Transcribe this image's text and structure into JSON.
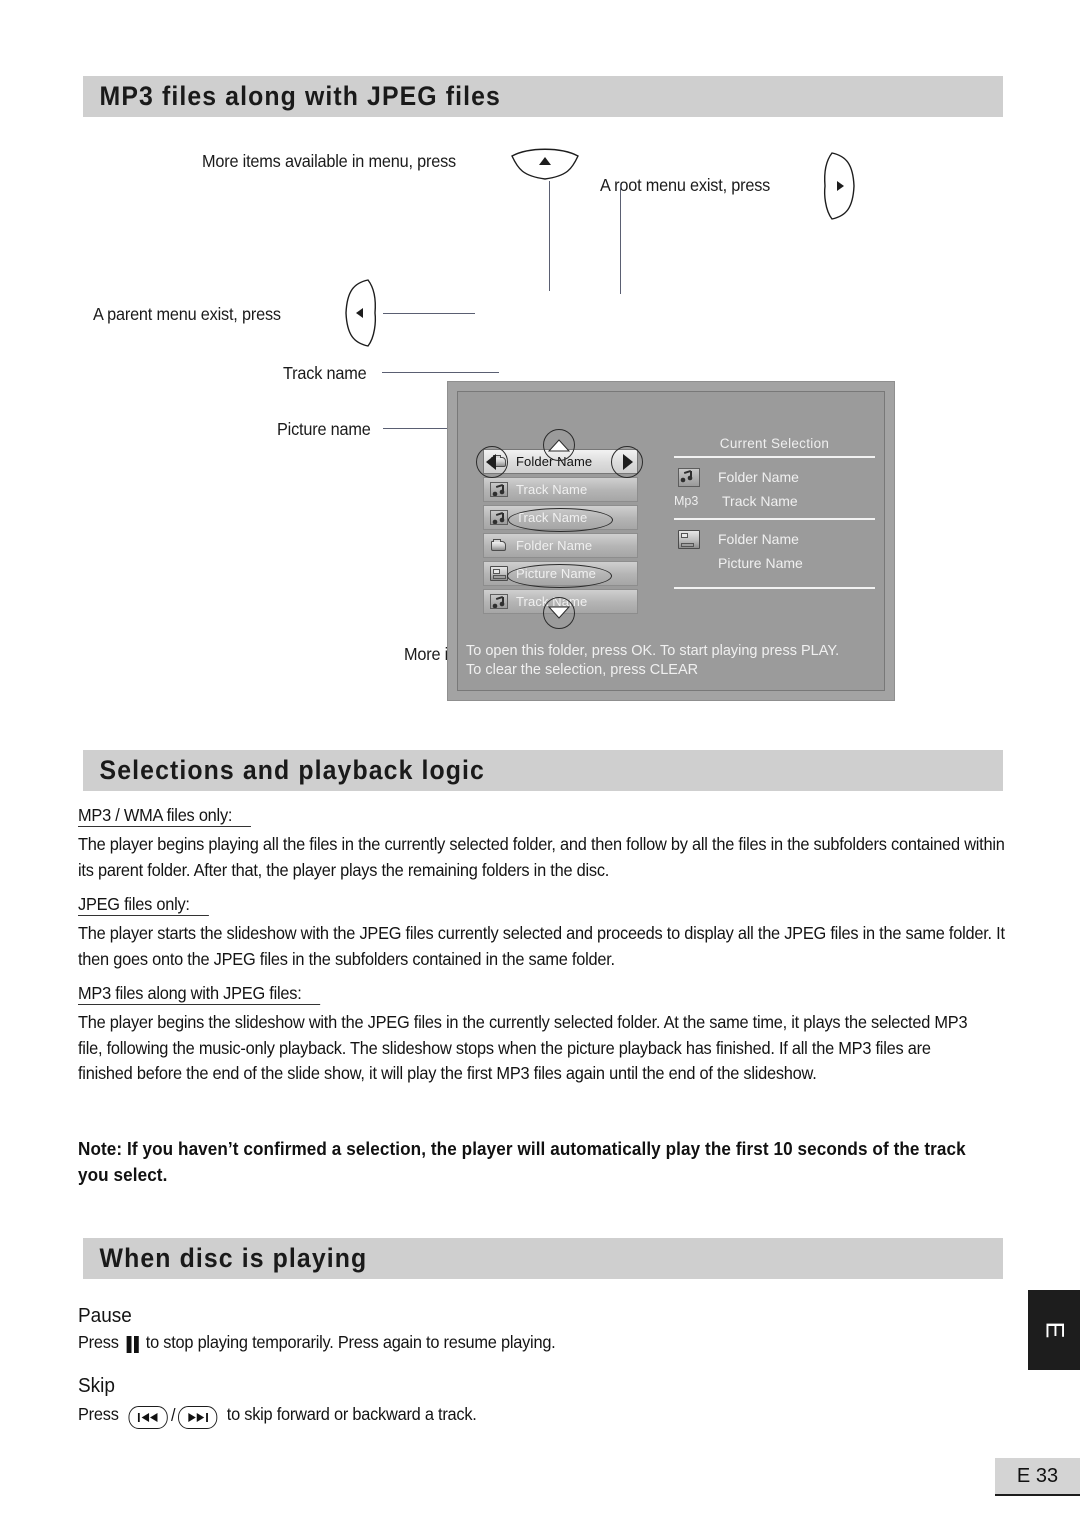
{
  "sections": {
    "mp3_jpeg": {
      "title": "MP3 files along with JPEG files"
    },
    "selections": {
      "title": "Selections and playback logic"
    },
    "when_playing": {
      "title": "When disc is playing"
    }
  },
  "diagram": {
    "callouts": {
      "more_items_top": "More items available in menu, press",
      "root_menu": "A root menu exist, press",
      "parent_menu": "A parent menu exist, press",
      "track_name": "Track name",
      "picture_name": "Picture name",
      "more_items_bottom": "More items available in menu, press"
    },
    "keys": {
      "up": "up-arrow-key",
      "down": "down-arrow-key",
      "left": "left-arrow-key",
      "right": "right-arrow-key"
    },
    "osd": {
      "menu_rows": [
        {
          "icon": "folder",
          "label": "Folder Name",
          "selected": true
        },
        {
          "icon": "music",
          "label": "Track Name",
          "selected": false
        },
        {
          "icon": "music",
          "label": "Track Name",
          "selected": false
        },
        {
          "icon": "folder",
          "label": "Folder Name",
          "selected": false
        },
        {
          "icon": "picture",
          "label": "Picture Name",
          "selected": false
        },
        {
          "icon": "music",
          "label": "Track Name",
          "selected": false
        }
      ],
      "current_selection": {
        "title": "Current Selection",
        "group_one": [
          {
            "icon": "music",
            "label": "Folder Name",
            "tag": ""
          },
          {
            "icon": "none",
            "label": "Track Name",
            "tag": "Mp3"
          }
        ],
        "group_two": [
          {
            "icon": "folder",
            "label": "Folder Name",
            "tag": ""
          },
          {
            "icon": "none",
            "label": "Picture Name",
            "tag": ""
          }
        ]
      },
      "hint_line_1": "To open this folder, press OK. To start playing press PLAY.",
      "hint_line_2": "To clear the selection, press CLEAR"
    }
  },
  "selections_body": {
    "mp3wma_heading": "MP3 / WMA files only:",
    "mp3wma_text": "The player begins playing all the files in the currently selected folder, and then follow by all the files in the subfolders contained within its parent folder.  After that, the player plays the remaining folders in the disc.",
    "jpeg_heading": "JPEG files only:",
    "jpeg_text": "The player starts the slideshow with the JPEG files currently selected and proceeds to display all the JPEG files in the same folder.  It then goes onto the JPEG files in the subfolders contained in the same folder.",
    "both_heading": "MP3 files along with JPEG files:",
    "both_text": "The player begins the slideshow with the JPEG files in the currently selected folder.  At the same time, it plays the selected MP3 file, following the music-only playback.  The slideshow stops when the picture playback has finished.  If all the MP3 files are finished before the end of the slide show, it will play the first MP3 files again until the end of the slideshow.",
    "note": "Note:  If you haven’t confirmed a selection, the player will automatically play the first 10 seconds of the track you select."
  },
  "when_playing_body": {
    "pause_heading": "Pause",
    "pause_prefix": "Press",
    "pause_text": "to stop playing temporarily. Press again to resume playing.",
    "skip_heading": "Skip",
    "skip_prefix": "Press",
    "skip_separator": "/",
    "skip_text": "to skip forward or backward a track."
  },
  "footer": {
    "tab_letter": "E",
    "page_number": "E 33"
  }
}
